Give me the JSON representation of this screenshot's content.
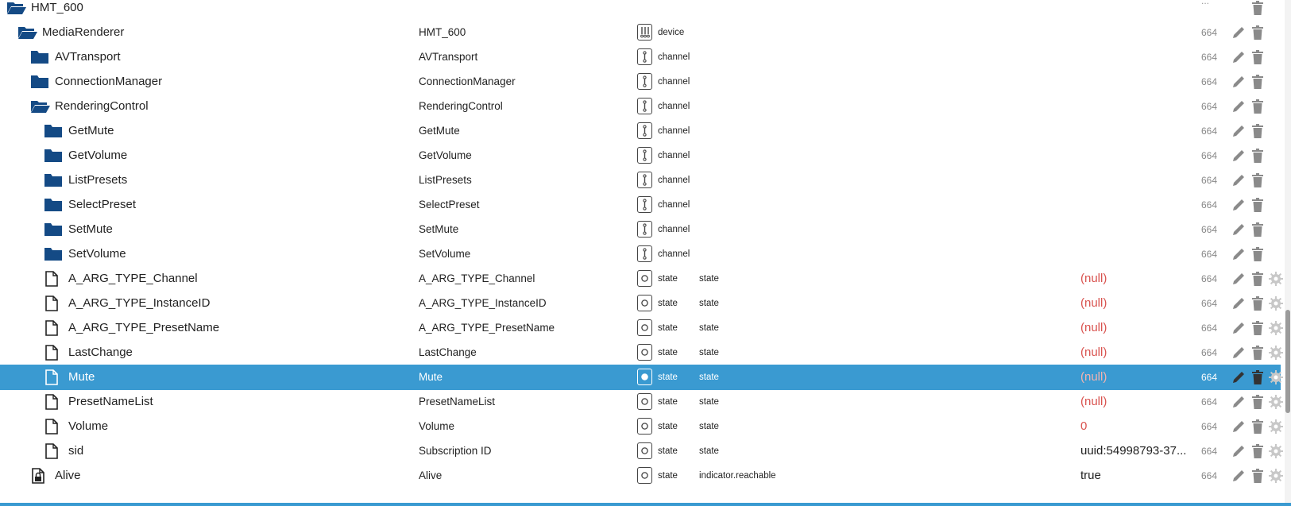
{
  "colors": {
    "folder": "#144a85",
    "selected_bg": "#3a9ad1",
    "null_text": "#d9534f",
    "icon_grey": "#8a8a8a",
    "gear_grey": "#c8c8c8"
  },
  "top_partial": {
    "acl": "..."
  },
  "rows": [
    {
      "name": "HMT_600",
      "name2": "",
      "type": "",
      "role": "",
      "value": "",
      "acl": "",
      "icon": "folder-open-icon",
      "role_icon": "",
      "indent": 0,
      "gear": false,
      "selected": false
    },
    {
      "name": "MediaRenderer",
      "name2": "HMT_600",
      "type": "device",
      "role": "",
      "value": "",
      "acl": "664",
      "icon": "folder-open-icon",
      "role_icon": "device-icon",
      "indent": 1,
      "gear": false,
      "selected": false
    },
    {
      "name": "AVTransport",
      "name2": "AVTransport",
      "type": "channel",
      "role": "",
      "value": "",
      "acl": "664",
      "icon": "folder-icon",
      "role_icon": "channel-icon",
      "indent": 2,
      "gear": false,
      "selected": false
    },
    {
      "name": "ConnectionManager",
      "name2": "ConnectionManager",
      "type": "channel",
      "role": "",
      "value": "",
      "acl": "664",
      "icon": "folder-icon",
      "role_icon": "channel-icon",
      "indent": 2,
      "gear": false,
      "selected": false
    },
    {
      "name": "RenderingControl",
      "name2": "RenderingControl",
      "type": "channel",
      "role": "",
      "value": "",
      "acl": "664",
      "icon": "folder-open-icon",
      "role_icon": "channel-icon",
      "indent": 2,
      "gear": false,
      "selected": false
    },
    {
      "name": "GetMute",
      "name2": "GetMute",
      "type": "channel",
      "role": "",
      "value": "",
      "acl": "664",
      "icon": "folder-icon",
      "role_icon": "channel-icon",
      "indent": 3,
      "gear": false,
      "selected": false
    },
    {
      "name": "GetVolume",
      "name2": "GetVolume",
      "type": "channel",
      "role": "",
      "value": "",
      "acl": "664",
      "icon": "folder-icon",
      "role_icon": "channel-icon",
      "indent": 3,
      "gear": false,
      "selected": false
    },
    {
      "name": "ListPresets",
      "name2": "ListPresets",
      "type": "channel",
      "role": "",
      "value": "",
      "acl": "664",
      "icon": "folder-icon",
      "role_icon": "channel-icon",
      "indent": 3,
      "gear": false,
      "selected": false
    },
    {
      "name": "SelectPreset",
      "name2": "SelectPreset",
      "type": "channel",
      "role": "",
      "value": "",
      "acl": "664",
      "icon": "folder-icon",
      "role_icon": "channel-icon",
      "indent": 3,
      "gear": false,
      "selected": false
    },
    {
      "name": "SetMute",
      "name2": "SetMute",
      "type": "channel",
      "role": "",
      "value": "",
      "acl": "664",
      "icon": "folder-icon",
      "role_icon": "channel-icon",
      "indent": 3,
      "gear": false,
      "selected": false
    },
    {
      "name": "SetVolume",
      "name2": "SetVolume",
      "type": "channel",
      "role": "",
      "value": "",
      "acl": "664",
      "icon": "folder-icon",
      "role_icon": "channel-icon",
      "indent": 3,
      "gear": false,
      "selected": false
    },
    {
      "name": "A_ARG_TYPE_Channel",
      "name2": "A_ARG_TYPE_Channel",
      "type": "state",
      "role": "state",
      "value": "(null)",
      "acl": "664",
      "icon": "file-icon",
      "role_icon": "state-icon",
      "indent": 3,
      "gear": true,
      "selected": false
    },
    {
      "name": "A_ARG_TYPE_InstanceID",
      "name2": "A_ARG_TYPE_InstanceID",
      "type": "state",
      "role": "state",
      "value": "(null)",
      "acl": "664",
      "icon": "file-icon",
      "role_icon": "state-icon",
      "indent": 3,
      "gear": true,
      "selected": false
    },
    {
      "name": "A_ARG_TYPE_PresetName",
      "name2": "A_ARG_TYPE_PresetName",
      "type": "state",
      "role": "state",
      "value": "(null)",
      "acl": "664",
      "icon": "file-icon",
      "role_icon": "state-icon",
      "indent": 3,
      "gear": true,
      "selected": false
    },
    {
      "name": "LastChange",
      "name2": "LastChange",
      "type": "state",
      "role": "state",
      "value": "(null)",
      "acl": "664",
      "icon": "file-icon",
      "role_icon": "state-icon",
      "indent": 3,
      "gear": true,
      "selected": false
    },
    {
      "name": "Mute",
      "name2": "Mute",
      "type": "state",
      "role": "state",
      "value": "(null)",
      "acl": "664",
      "icon": "file-icon",
      "role_icon": "state-icon",
      "indent": 3,
      "gear": true,
      "selected": true
    },
    {
      "name": "PresetNameList",
      "name2": "PresetNameList",
      "type": "state",
      "role": "state",
      "value": "(null)",
      "acl": "664",
      "icon": "file-icon",
      "role_icon": "state-icon",
      "indent": 3,
      "gear": true,
      "selected": false
    },
    {
      "name": "Volume",
      "name2": "Volume",
      "type": "state",
      "role": "state",
      "value": "0",
      "acl": "664",
      "icon": "file-icon",
      "role_icon": "state-icon",
      "indent": 3,
      "gear": true,
      "selected": false
    },
    {
      "name": "sid",
      "name2": "Subscription ID",
      "type": "state",
      "role": "state",
      "value": "uuid:54998793-37...",
      "acl": "664",
      "icon": "file-icon",
      "role_icon": "state-icon",
      "indent": 3,
      "gear": true,
      "selected": false
    },
    {
      "name": "Alive",
      "name2": "Alive",
      "type": "state",
      "role": "indicator.reachable",
      "value": "true",
      "acl": "664",
      "icon": "file-lock-icon",
      "role_icon": "state-icon",
      "indent": 2,
      "gear": true,
      "selected": false
    }
  ]
}
